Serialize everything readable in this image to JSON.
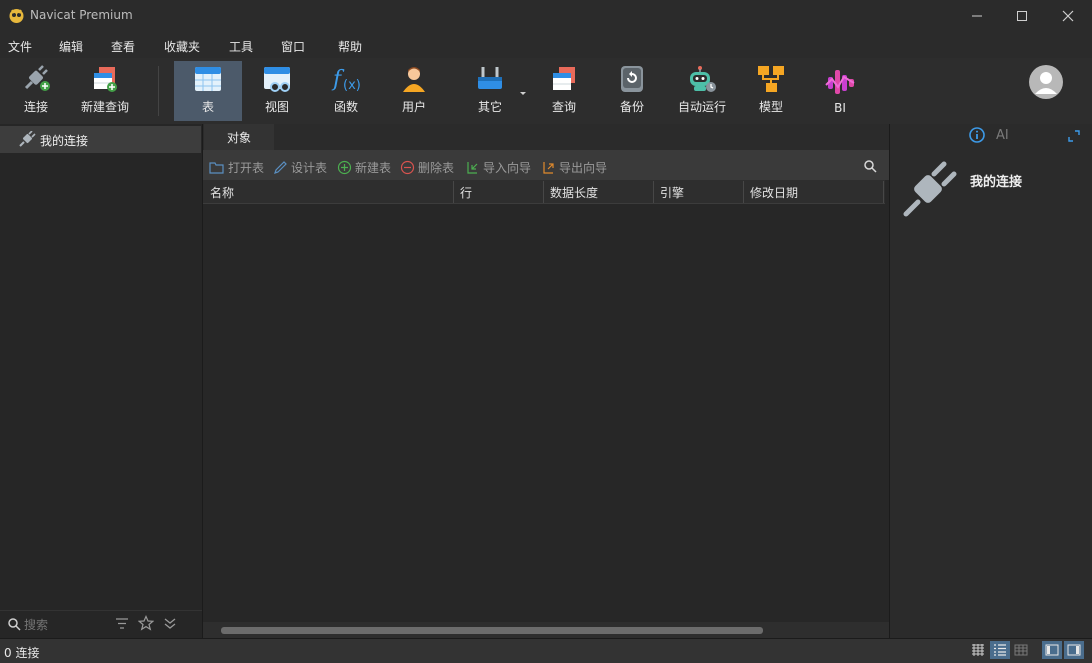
{
  "window": {
    "title": "Navicat Premium"
  },
  "menu": [
    "文件",
    "编辑",
    "查看",
    "收藏夹",
    "工具",
    "窗口",
    "帮助"
  ],
  "toolbar": {
    "connect": "连接",
    "new_query": "新建查询",
    "table": "表",
    "view": "视图",
    "function": "函数",
    "user": "用户",
    "other": "其它",
    "query": "查询",
    "backup": "备份",
    "automation": "自动运行",
    "model": "模型",
    "bi": "BI"
  },
  "sidebar": {
    "connection": "我的连接",
    "search_placeholder": "搜索"
  },
  "tabs": {
    "objects": "对象"
  },
  "objects_toolbar": {
    "open_table": "打开表",
    "design_table": "设计表",
    "new_table": "新建表",
    "delete_table": "删除表",
    "import_wizard": "导入向导",
    "export_wizard": "导出向导"
  },
  "columns": [
    "名称",
    "行",
    "数据长度",
    "引擎",
    "修改日期"
  ],
  "info_panel": {
    "title": "我的连接",
    "ai_label": "AI"
  },
  "status": {
    "connections": "0 连接"
  }
}
